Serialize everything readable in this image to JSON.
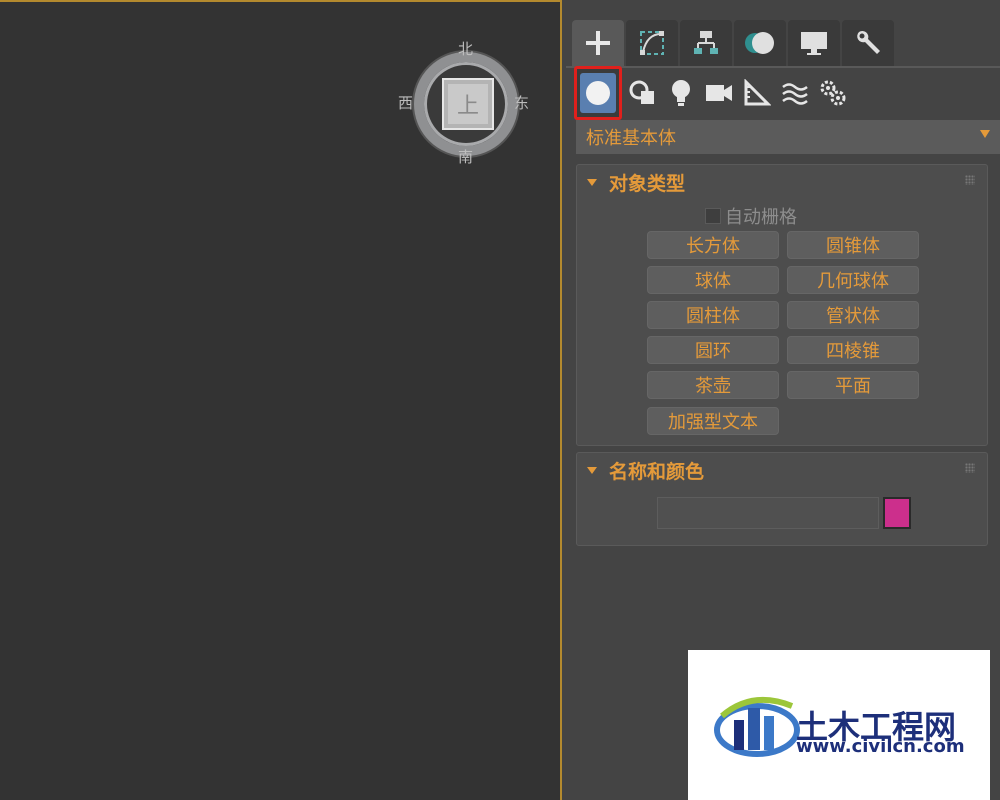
{
  "viewport": {
    "viewcube_face": "上",
    "compass": {
      "north": "北",
      "south": "南",
      "west": "西",
      "east": "东"
    }
  },
  "panel": {
    "tabs": [
      {
        "icon": "plus-icon",
        "active": true
      },
      {
        "icon": "modify-curve-icon",
        "active": false
      },
      {
        "icon": "hierarchy-icon",
        "active": false
      },
      {
        "icon": "motion-icon",
        "active": false
      },
      {
        "icon": "display-monitor-icon",
        "active": false
      },
      {
        "icon": "wrench-icon",
        "active": false
      }
    ],
    "category_icons": [
      {
        "icon": "geometry-sphere-icon",
        "selected": true
      },
      {
        "icon": "shapes-icon",
        "selected": false
      },
      {
        "icon": "light-bulb-icon",
        "selected": false
      },
      {
        "icon": "camera-icon",
        "selected": false
      },
      {
        "icon": "helpers-ruler-icon",
        "selected": false
      },
      {
        "icon": "spacewarps-icon",
        "selected": false
      },
      {
        "icon": "systems-gears-icon",
        "selected": false
      }
    ],
    "primitive_type_dropdown": "标准基本体",
    "object_type_rollout": {
      "title": "对象类型",
      "autogrid_label": "自动栅格",
      "autogrid_checked": false,
      "buttons": [
        "长方体",
        "圆锥体",
        "球体",
        "几何球体",
        "圆柱体",
        "管状体",
        "圆环",
        "四棱锥",
        "茶壶",
        "平面",
        "加强型文本"
      ]
    },
    "name_color_rollout": {
      "title": "名称和颜色",
      "name_value": "",
      "color": "#cc2f8c"
    }
  },
  "accent_color": "#e49a3a",
  "watermark": {
    "title": "土木工程网",
    "url": "www.civilcn.com"
  }
}
